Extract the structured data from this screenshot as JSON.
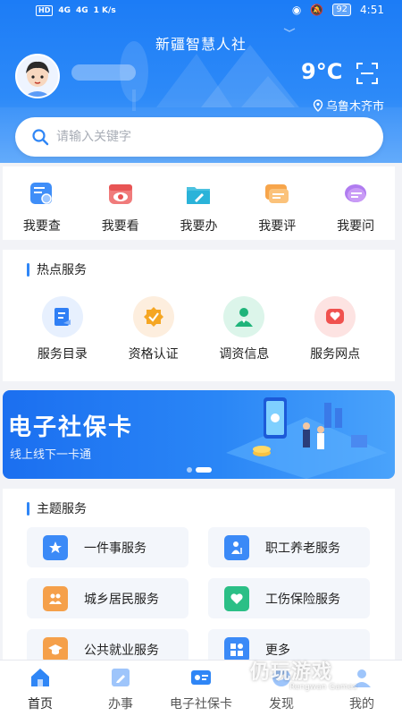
{
  "status_bar": {
    "network_left": [
      "HD",
      "4G",
      "4G"
    ],
    "speed": "1 K/s",
    "battery": "92",
    "time": "4:51"
  },
  "header": {
    "app_title": "新疆智慧人社",
    "temperature": "9°C",
    "location": "乌鲁木齐市"
  },
  "search": {
    "placeholder": "请输入关键字"
  },
  "quick_menu": [
    {
      "label": "我要查",
      "icon": "search-doc-icon"
    },
    {
      "label": "我要看",
      "icon": "eye-icon"
    },
    {
      "label": "我要办",
      "icon": "folder-pen-icon"
    },
    {
      "label": "我要评",
      "icon": "comment-icon"
    },
    {
      "label": "我要问",
      "icon": "question-chat-icon"
    }
  ],
  "hot_services": {
    "title": "热点服务",
    "items": [
      {
        "label": "服务目录",
        "icon": "catalog-icon",
        "color": "#2f7ff5"
      },
      {
        "label": "资格认证",
        "icon": "certify-icon",
        "color": "#f5a623"
      },
      {
        "label": "调资信息",
        "icon": "person-icon",
        "color": "#1fb47a"
      },
      {
        "label": "服务网点",
        "icon": "heart-location-icon",
        "color": "#f0524f"
      }
    ]
  },
  "banner": {
    "title": "电子社保卡",
    "subtitle": "线上线下一卡通"
  },
  "theme_services": {
    "title": "主题服务",
    "items": [
      {
        "label": "一件事服务",
        "icon": "star-badge-icon",
        "color": "#3b8af7"
      },
      {
        "label": "职工养老服务",
        "icon": "elder-icon",
        "color": "#3b8af7"
      },
      {
        "label": "城乡居民服务",
        "icon": "residents-icon",
        "color": "#f5a04a"
      },
      {
        "label": "工伤保险服务",
        "icon": "heart-icon",
        "color": "#2bbf86"
      },
      {
        "label": "公共就业服务",
        "icon": "graduate-icon",
        "color": "#f5a04a"
      },
      {
        "label": "更多",
        "icon": "grid-icon",
        "color": "#3b8af7"
      }
    ]
  },
  "tabbar": [
    {
      "label": "首页",
      "icon": "home-icon",
      "active": true
    },
    {
      "label": "办事",
      "icon": "edit-icon",
      "active": false
    },
    {
      "label": "电子社保卡",
      "icon": "card-icon",
      "active": false
    },
    {
      "label": "发现",
      "icon": "discover-icon",
      "active": false
    },
    {
      "label": "我的",
      "icon": "user-icon",
      "active": false
    }
  ],
  "watermark": {
    "main": "仍玩游戏",
    "sub": "Rengwan Games"
  }
}
